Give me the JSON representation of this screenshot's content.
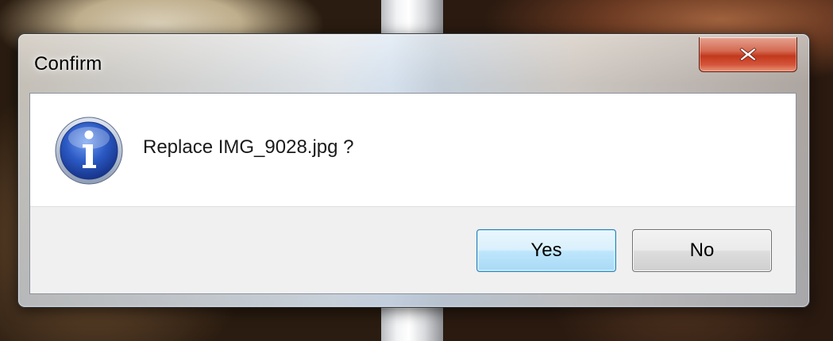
{
  "dialog": {
    "title": "Confirm",
    "message": "Replace IMG_9028.jpg ?",
    "icon": "info-icon",
    "buttons": {
      "yes_label": "Yes",
      "no_label": "No"
    },
    "close_icon": "close-icon"
  },
  "colors": {
    "close_button": "#c2391d",
    "default_button_border": "#3c7fb1",
    "info_icon": "#2b59c3"
  }
}
